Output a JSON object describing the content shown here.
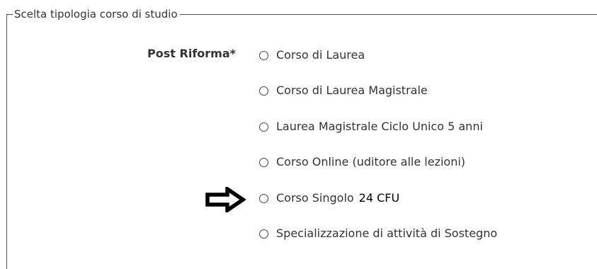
{
  "form": {
    "legend": "Scelta tipologia corso di studio",
    "group_label": "Post Riforma*",
    "options": [
      {
        "label": "Corso di Laurea",
        "extra": "",
        "selected": false
      },
      {
        "label": "Corso di Laurea Magistrale",
        "extra": "",
        "selected": false
      },
      {
        "label": "Laurea Magistrale Ciclo Unico 5 anni",
        "extra": "",
        "selected": false
      },
      {
        "label": "Corso Online (uditore alle lezioni)",
        "extra": "",
        "selected": false
      },
      {
        "label": "Corso Singolo",
        "extra": "24 CFU",
        "selected": false
      },
      {
        "label": "Specializzazione di attività di Sostegno",
        "extra": "",
        "selected": false
      }
    ]
  },
  "annotation": {
    "icon": "right-arrow-icon",
    "points_to_option": "Corso Singolo"
  },
  "colors": {
    "text": "#333333",
    "border": "#555555",
    "arrow": "#000000"
  }
}
